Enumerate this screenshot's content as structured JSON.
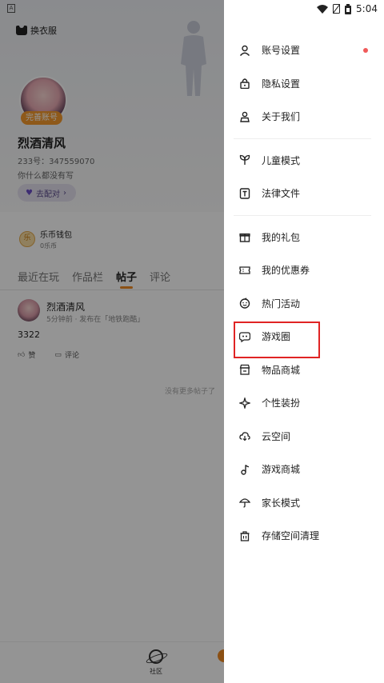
{
  "status_bar": {
    "time": "5:04"
  },
  "profile": {
    "skin_button": "换衣服",
    "badge": "完善账号",
    "name": "烈酒清风",
    "id_text": "233号：347559070",
    "signature": "你什么都没有写",
    "pair_button": "去配对",
    "wallet_title": "乐币钱包",
    "wallet_balance": "0乐币",
    "coin_glyph": "乐"
  },
  "tabs": [
    {
      "label": "最近在玩",
      "active": false
    },
    {
      "label": "作品栏",
      "active": false
    },
    {
      "label": "帖子",
      "active": true
    },
    {
      "label": "评论",
      "active": false
    }
  ],
  "post": {
    "author": "烈酒清风",
    "meta": "5分钟前 · 发布在「地铁跑酷」",
    "body": "3322",
    "like_label": "赞",
    "comment_label": "评论"
  },
  "no_more_text": "没有更多帖子了",
  "bottom_nav": {
    "community_label": "社区"
  },
  "menu": {
    "group1": [
      {
        "label": "账号设置",
        "icon": "person-icon",
        "has_dot": true
      },
      {
        "label": "隐私设置",
        "icon": "lock-icon"
      },
      {
        "label": "关于我们",
        "icon": "user-outline-icon"
      }
    ],
    "group2": [
      {
        "label": "儿童模式",
        "icon": "sprout-icon"
      },
      {
        "label": "法律文件",
        "icon": "document-icon"
      }
    ],
    "group3": [
      {
        "label": "我的礼包",
        "icon": "gift-icon"
      },
      {
        "label": "我的优惠券",
        "icon": "coupon-icon"
      },
      {
        "label": "热门活动",
        "icon": "smile-icon"
      },
      {
        "label": "游戏圈",
        "icon": "gamepad-bubble-icon",
        "highlighted": true
      },
      {
        "label": "物品商城",
        "icon": "store-icon"
      },
      {
        "label": "个性装扮",
        "icon": "sparkle-icon"
      },
      {
        "label": "云空间",
        "icon": "cloud-icon"
      },
      {
        "label": "游戏商城",
        "icon": "music-note-icon"
      },
      {
        "label": "家长模式",
        "icon": "umbrella-icon"
      },
      {
        "label": "存储空间清理",
        "icon": "trash-icon"
      }
    ]
  },
  "colors": {
    "accent": "#f08a24",
    "dot": "#f05a5a",
    "highlight_box": "#e02424"
  }
}
